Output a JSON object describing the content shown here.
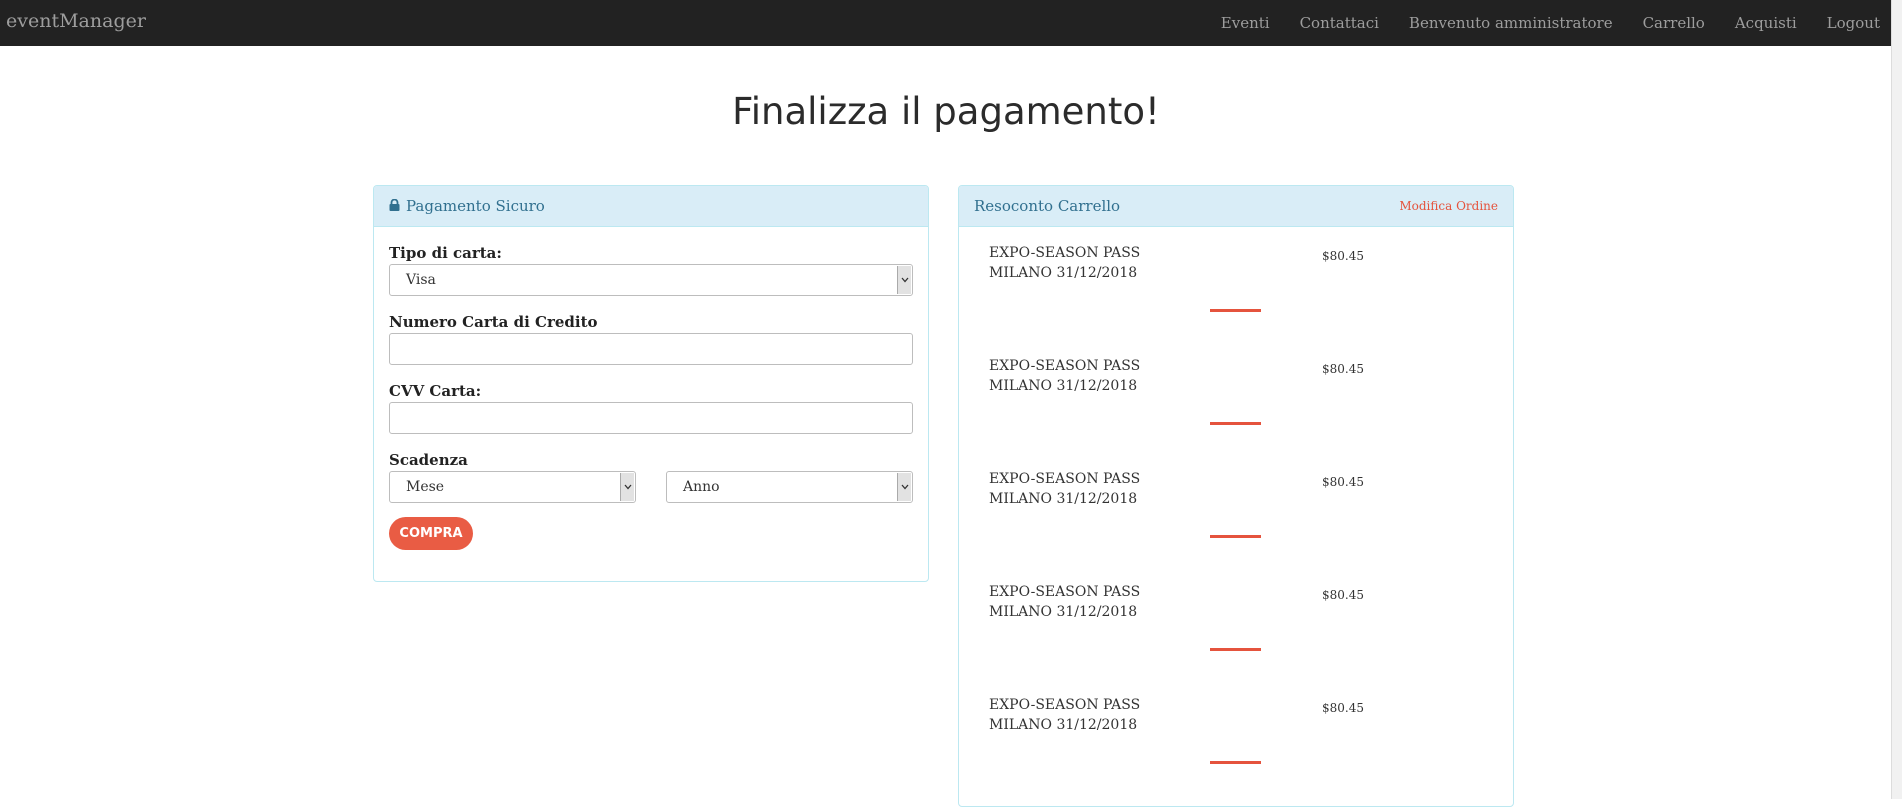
{
  "navbar": {
    "brand": "eventManager",
    "links": [
      "Eventi",
      "Contattaci",
      "Benvenuto amministratore",
      "Carrello",
      "Acquisti",
      "Logout"
    ]
  },
  "page_title": "Finalizza il pagamento!",
  "payment": {
    "heading": "Pagamento Sicuro",
    "card_type_label": "Tipo di carta:",
    "card_type_value": "Visa",
    "card_number_label": "Numero Carta di Credito",
    "card_number_value": "",
    "cvv_label": "CVV Carta:",
    "cvv_value": "",
    "expiry_label": "Scadenza",
    "month_value": "Mese",
    "year_value": "Anno",
    "buy_button": "COMPRA"
  },
  "cart": {
    "heading": "Resoconto Carrello",
    "edit_link": "Modifica Ordine",
    "items": [
      {
        "name_line1": "EXPO-SEASON PASS",
        "name_line2": "MILANO 31/12/2018",
        "price": "$80.45"
      },
      {
        "name_line1": "EXPO-SEASON PASS",
        "name_line2": "MILANO 31/12/2018",
        "price": "$80.45"
      },
      {
        "name_line1": "EXPO-SEASON PASS",
        "name_line2": "MILANO 31/12/2018",
        "price": "$80.45"
      },
      {
        "name_line1": "EXPO-SEASON PASS",
        "name_line2": "MILANO 31/12/2018",
        "price": "$80.45"
      },
      {
        "name_line1": "EXPO-SEASON PASS",
        "name_line2": "MILANO 31/12/2018",
        "price": "$80.45"
      }
    ]
  },
  "colors": {
    "navbar_bg": "#222222",
    "panel_heading_bg": "#d9edf7",
    "accent": "#e95c44"
  },
  "icons": {
    "lock": "lock-icon",
    "caret": "caret-down-icon"
  }
}
